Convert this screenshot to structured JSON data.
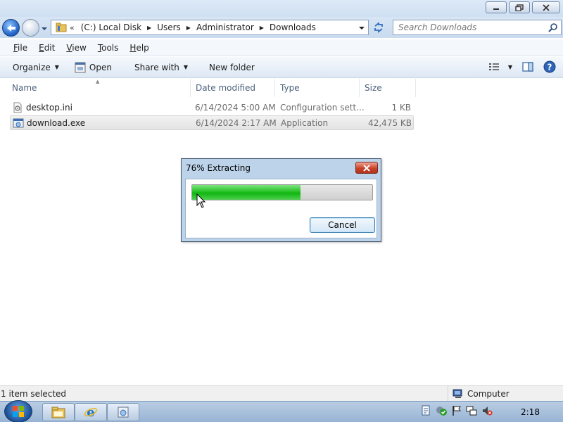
{
  "window": {
    "controls": [
      "minimize",
      "maximize",
      "close"
    ]
  },
  "navigation": {
    "breadcrumb_overflow": "«",
    "breadcrumb": [
      "(C:) Local Disk",
      "Users",
      "Administrator",
      "Downloads"
    ],
    "search_placeholder": "Search Downloads"
  },
  "menu": {
    "items": [
      {
        "underline": "F",
        "rest": "ile"
      },
      {
        "underline": "E",
        "rest": "dit"
      },
      {
        "underline": "V",
        "rest": "iew"
      },
      {
        "underline": "T",
        "rest": "ools"
      },
      {
        "underline": "H",
        "rest": "elp"
      }
    ]
  },
  "toolbar": {
    "organize": "Organize",
    "open": "Open",
    "share_with": "Share with",
    "new_folder": "New folder"
  },
  "columns": {
    "name": "Name",
    "date_modified": "Date modified",
    "type": "Type",
    "size": "Size"
  },
  "files": [
    {
      "name": "desktop.ini",
      "date": "6/14/2024 5:00 AM",
      "type": "Configuration sett...",
      "size": "1 KB",
      "icon": "settings-file-icon",
      "selected": false
    },
    {
      "name": "download.exe",
      "date": "6/14/2024 2:17 AM",
      "type": "Application",
      "size": "42,475 KB",
      "icon": "application-icon",
      "selected": true
    }
  ],
  "dialog": {
    "title": "76% Extracting",
    "progress": 0.6,
    "cancel_label": "Cancel"
  },
  "status": {
    "selection": "1 item selected",
    "location": "Computer"
  },
  "taskbar": {
    "clock": "2:18",
    "apps": [
      "windows-explorer-icon",
      "internet-explorer-icon",
      "installer-icon"
    ]
  },
  "colors": {
    "progress_fill": "#17b817",
    "selected_row": "#e6e6e6",
    "dialog_frame": "#bcd3ea",
    "close_button": "#c8432a"
  }
}
